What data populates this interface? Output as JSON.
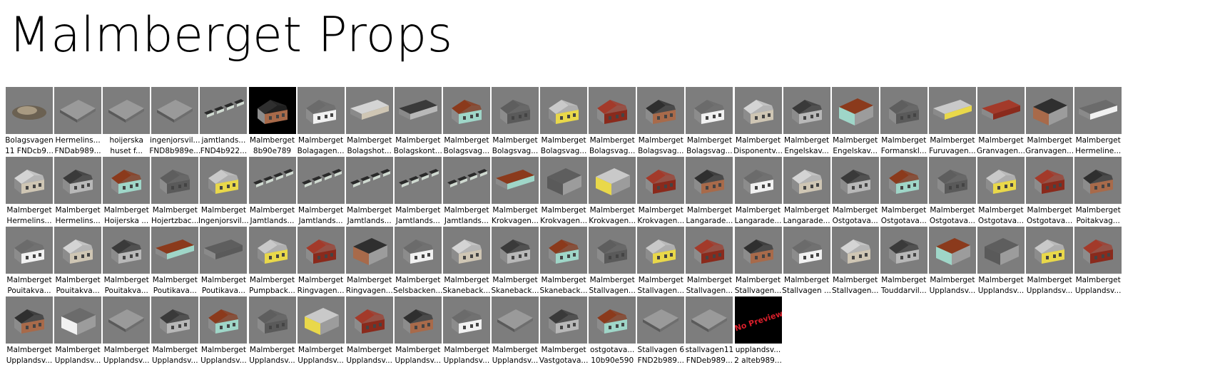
{
  "page": {
    "title": "Malmberget Props"
  },
  "items": [
    {
      "l1": "Bolagsvagen",
      "l2": "11 FNDcb9...",
      "kind": "rubble"
    },
    {
      "l1": "Hermelins...",
      "l2": "FNDab989...",
      "kind": "flat"
    },
    {
      "l1": "hoijerska",
      "l2": "huset f...",
      "kind": "flat"
    },
    {
      "l1": "ingenjorsvil...",
      "l2": "FND8b989e...",
      "kind": "flat"
    },
    {
      "l1": "jamtlands...",
      "l2": "FND4b922...",
      "kind": "row"
    },
    {
      "l1": "Malmberget",
      "l2": "8b90e789",
      "kind": "black-house"
    },
    {
      "l1": "Malmberget",
      "l2": "Bolagagen...",
      "kind": "house"
    },
    {
      "l1": "Malmberget",
      "l2": "Bolagshot...",
      "kind": "long"
    },
    {
      "l1": "Malmberget",
      "l2": "Bolagskont...",
      "kind": "long"
    },
    {
      "l1": "Malmberget",
      "l2": "Bolagsvag...",
      "kind": "house"
    },
    {
      "l1": "Malmberget",
      "l2": "Bolagsvag...",
      "kind": "house"
    },
    {
      "l1": "Malmberget",
      "l2": "Bolagsvag...",
      "kind": "house"
    },
    {
      "l1": "Malmberget",
      "l2": "Bolagsvag...",
      "kind": "house"
    },
    {
      "l1": "Malmberget",
      "l2": "Bolagsvag...",
      "kind": "house"
    },
    {
      "l1": "Malmberget",
      "l2": "Bolagsvag...",
      "kind": "house"
    },
    {
      "l1": "Malmberget",
      "l2": "Disponentv...",
      "kind": "house"
    },
    {
      "l1": "Malmberget",
      "l2": "Engelskav...",
      "kind": "house"
    },
    {
      "l1": "Malmberget",
      "l2": "Engelskav...",
      "kind": "block"
    },
    {
      "l1": "Malmberget",
      "l2": "Formanskl...",
      "kind": "house"
    },
    {
      "l1": "Malmberget",
      "l2": "Furuvagen...",
      "kind": "long"
    },
    {
      "l1": "Malmberget",
      "l2": "Granvagen...",
      "kind": "long"
    },
    {
      "l1": "Malmberget",
      "l2": "Granvagen...",
      "kind": "block"
    },
    {
      "l1": "Malmberget",
      "l2": "Hermeline...",
      "kind": "long"
    },
    {
      "l1": "Malmberget",
      "l2": "Hermelins...",
      "kind": "house"
    },
    {
      "l1": "Malmberget",
      "l2": "Hermelins...",
      "kind": "house"
    },
    {
      "l1": "Malmberget",
      "l2": "Hoijerska ...",
      "kind": "house"
    },
    {
      "l1": "Malmberget",
      "l2": "Hojertzbac...",
      "kind": "house"
    },
    {
      "l1": "Malmberget",
      "l2": "Ingenjorsvil...",
      "kind": "house"
    },
    {
      "l1": "Malmberget",
      "l2": "Jamtlands...",
      "kind": "row"
    },
    {
      "l1": "Malmberget",
      "l2": "Jamtlands...",
      "kind": "row"
    },
    {
      "l1": "Malmberget",
      "l2": "Jamtlands...",
      "kind": "row"
    },
    {
      "l1": "Malmberget",
      "l2": "Jamtlands...",
      "kind": "row"
    },
    {
      "l1": "Malmberget",
      "l2": "Jamtlands...",
      "kind": "row"
    },
    {
      "l1": "Malmberget",
      "l2": "Krokvagen...",
      "kind": "long"
    },
    {
      "l1": "Malmberget",
      "l2": "Krokvagen...",
      "kind": "block"
    },
    {
      "l1": "Malmberget",
      "l2": "Krokvagen...",
      "kind": "block"
    },
    {
      "l1": "Malmberget",
      "l2": "Krokvagen...",
      "kind": "house"
    },
    {
      "l1": "Malmberget",
      "l2": "Langarade...",
      "kind": "house"
    },
    {
      "l1": "Malmberget",
      "l2": "Langarade...",
      "kind": "house"
    },
    {
      "l1": "Malmberget",
      "l2": "Langarade...",
      "kind": "house"
    },
    {
      "l1": "Malmberget",
      "l2": "Ostgotava...",
      "kind": "house"
    },
    {
      "l1": "Malmberget",
      "l2": "Ostgotava...",
      "kind": "house"
    },
    {
      "l1": "Malmberget",
      "l2": "Ostgotava...",
      "kind": "house"
    },
    {
      "l1": "Malmberget",
      "l2": "Ostgotava...",
      "kind": "house"
    },
    {
      "l1": "Malmberget",
      "l2": "Ostgotava...",
      "kind": "house"
    },
    {
      "l1": "Malmberget",
      "l2": "Poitakvag...",
      "kind": "house"
    },
    {
      "l1": "Malmberget",
      "l2": "Pouitakva...",
      "kind": "house"
    },
    {
      "l1": "Malmberget",
      "l2": "Pouitakva...",
      "kind": "house"
    },
    {
      "l1": "Malmberget",
      "l2": "Pouitakva...",
      "kind": "house"
    },
    {
      "l1": "Malmberget",
      "l2": "Poutikava...",
      "kind": "long"
    },
    {
      "l1": "Malmberget",
      "l2": "Poutikava...",
      "kind": "long"
    },
    {
      "l1": "Malmberget",
      "l2": "Pumpback...",
      "kind": "house"
    },
    {
      "l1": "Malmberget",
      "l2": "Ringvagen...",
      "kind": "house"
    },
    {
      "l1": "Malmberget",
      "l2": "Ringvagen...",
      "kind": "block"
    },
    {
      "l1": "Malmberget",
      "l2": "Selsbacken...",
      "kind": "house"
    },
    {
      "l1": "Malmberget",
      "l2": "Skaneback...",
      "kind": "house"
    },
    {
      "l1": "Malmberget",
      "l2": "Skaneback...",
      "kind": "house"
    },
    {
      "l1": "Malmberget",
      "l2": "Skaneback...",
      "kind": "house"
    },
    {
      "l1": "Malmberget",
      "l2": "Stallvagen...",
      "kind": "house"
    },
    {
      "l1": "Malmberget",
      "l2": "Stallvagen...",
      "kind": "house"
    },
    {
      "l1": "Malmberget",
      "l2": "Stallvagen...",
      "kind": "house"
    },
    {
      "l1": "Malmberget",
      "l2": "Stallvagen...",
      "kind": "house"
    },
    {
      "l1": "Malmberget",
      "l2": "Stallvagen ...",
      "kind": "house"
    },
    {
      "l1": "Malmberget",
      "l2": "Stallvagen...",
      "kind": "house"
    },
    {
      "l1": "Malmberget",
      "l2": "Touddarvil...",
      "kind": "house"
    },
    {
      "l1": "Malmberget",
      "l2": "Upplandsv...",
      "kind": "block"
    },
    {
      "l1": "Malmberget",
      "l2": "Upplandsv...",
      "kind": "block"
    },
    {
      "l1": "Malmberget",
      "l2": "Upplandsv...",
      "kind": "house"
    },
    {
      "l1": "Malmberget",
      "l2": "Upplandsv...",
      "kind": "house"
    },
    {
      "l1": "Malmberget",
      "l2": "Upplandsv...",
      "kind": "house"
    },
    {
      "l1": "Malmberget",
      "l2": "Upplandsv...",
      "kind": "block"
    },
    {
      "l1": "Malmberget",
      "l2": "Upplandsv...",
      "kind": "flat"
    },
    {
      "l1": "Malmberget",
      "l2": "Upplandsv...",
      "kind": "house"
    },
    {
      "l1": "Malmberget",
      "l2": "Upplandsv...",
      "kind": "house"
    },
    {
      "l1": "Malmberget",
      "l2": "Upplandsv...",
      "kind": "house"
    },
    {
      "l1": "Malmberget",
      "l2": "Upplandsv...",
      "kind": "block"
    },
    {
      "l1": "Malmberget",
      "l2": "Upplandsv...",
      "kind": "house"
    },
    {
      "l1": "Malmberget",
      "l2": "Upplandsv...",
      "kind": "house"
    },
    {
      "l1": "Malmberget",
      "l2": "Upplandsv...",
      "kind": "house"
    },
    {
      "l1": "Malmberget",
      "l2": "Upplandsv...",
      "kind": "flat"
    },
    {
      "l1": "Malmberget",
      "l2": "Vastgotava...",
      "kind": "house"
    },
    {
      "l1": "ostgotava...",
      "l2": "10b90e590",
      "kind": "house"
    },
    {
      "l1": "Stallvagen 6",
      "l2": "FND2b989...",
      "kind": "flat"
    },
    {
      "l1": "stallvagen11",
      "l2": "FNDeb989...",
      "kind": "flat"
    },
    {
      "l1": "upplandsv...",
      "l2": "2 alteb989...",
      "kind": "nopreview",
      "preview_text": "No Preview"
    }
  ],
  "colors": {
    "thumb_bg": "#7d7d7d",
    "roof_colors": [
      "#3a3a3a",
      "#8b3a1c",
      "#5e5e5e",
      "#c9c9c9",
      "#a33a2a",
      "#2f2f2f",
      "#6b6b6b",
      "#d4d4d4"
    ],
    "wall_colors": [
      "#b8b8b8",
      "#e9d84a",
      "#f1f1f1",
      "#9fd6c8",
      "#8a2a1c",
      "#cfc6b4",
      "#5a5a5a",
      "#a86a4a"
    ]
  }
}
